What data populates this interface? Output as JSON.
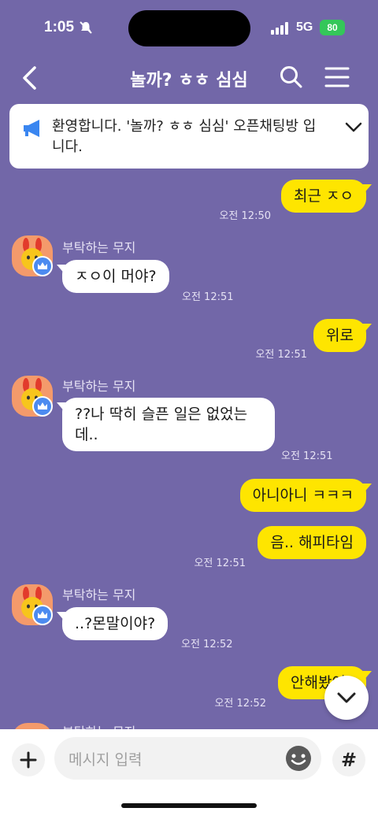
{
  "status": {
    "time": "1:05",
    "network": "5G",
    "battery": "80"
  },
  "header": {
    "title": "놀까? ㅎㅎ 심심"
  },
  "notice": {
    "text": "환영합니다. '놀까? ㅎㅎ 심심' 오픈채팅방 입니다."
  },
  "messages": [
    {
      "text": "최근 ㅈㅇ",
      "time": "오전 12:50"
    },
    {
      "sender": "부탁하는 무지",
      "text": "ㅈㅇ이 머야?",
      "time": "오전 12:51"
    },
    {
      "text": "위로",
      "time": "오전 12:51"
    },
    {
      "sender": "부탁하는 무지",
      "line1": "??나 딱히 슬픈 일은 없었는",
      "line2": "데..",
      "time": "오전 12:51"
    },
    {
      "text": "아니아니 ㅋㅋㅋ"
    },
    {
      "text": "음.. 해피타임",
      "time": "오전 12:51"
    },
    {
      "sender": "부탁하는 무지",
      "text": "..?몬말이야?",
      "time": "오전 12:52"
    },
    {
      "text": "안해봤어?",
      "time": "오전 12:52"
    },
    {
      "sender": "부탁하는 무지"
    }
  ],
  "composer": {
    "placeholder": "메시지 입력"
  },
  "colors": {
    "background": "#7267a8",
    "my_bubble": "#fee500",
    "other_bubble": "#ffffff"
  },
  "icons": [
    "back-icon",
    "search-icon",
    "menu-icon",
    "megaphone-icon",
    "chevron-down-icon",
    "crown-icon",
    "plus-icon",
    "emoji-icon",
    "hash-icon"
  ]
}
